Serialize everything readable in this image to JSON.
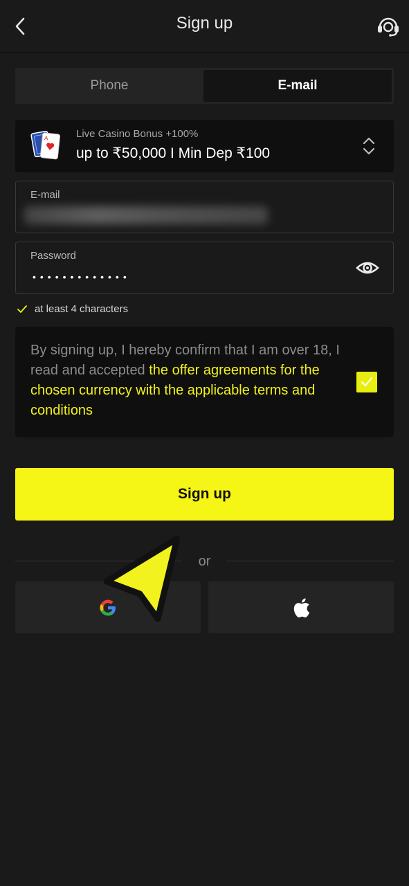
{
  "header": {
    "title": "Sign up",
    "back_icon": "chevron-left-icon",
    "support_icon": "headset-support-icon"
  },
  "tabs": [
    {
      "label": "Phone",
      "active": false
    },
    {
      "label": "E-mail",
      "active": true
    }
  ],
  "bonus": {
    "title": "Live Casino Bonus +100%",
    "description": "up to ₹50,000 I Min Dep ₹100",
    "icon": "playing-cards-icon"
  },
  "email_field": {
    "label": "E-mail",
    "value": ""
  },
  "password_field": {
    "label": "Password",
    "value": "•••••••••••••",
    "toggle_icon": "eye-icon"
  },
  "password_hint": "at least 4 characters",
  "agreement": {
    "text": "By signing up, I hereby confirm that I am over 18, I read and accepted ",
    "link": "the offer agreements for the chosen currency with the applicable terms and conditions",
    "checked": true
  },
  "signup_button": "Sign up",
  "divider_text": "or",
  "social": {
    "google_icon": "google-icon",
    "apple_icon": "apple-icon"
  },
  "colors": {
    "background": "#1a1a1a",
    "accent": "#f5f516",
    "link": "#f2f21e"
  }
}
